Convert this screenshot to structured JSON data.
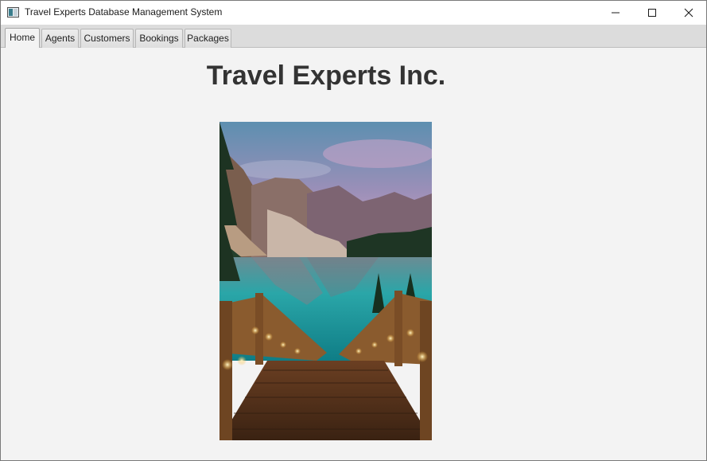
{
  "window": {
    "title": "Travel Experts Database Management System",
    "icon": "app-window-icon",
    "controls": [
      "minimize-icon",
      "maximize-icon",
      "close-icon"
    ]
  },
  "tabs": [
    {
      "label": "Home",
      "active": true
    },
    {
      "label": "Agents",
      "active": false
    },
    {
      "label": "Customers",
      "active": false
    },
    {
      "label": "Bookings",
      "active": false
    },
    {
      "label": "Packages",
      "active": false
    }
  ],
  "home": {
    "heading": "Travel Experts Inc.",
    "image": "mountain-lake-boardwalk-photo"
  }
}
